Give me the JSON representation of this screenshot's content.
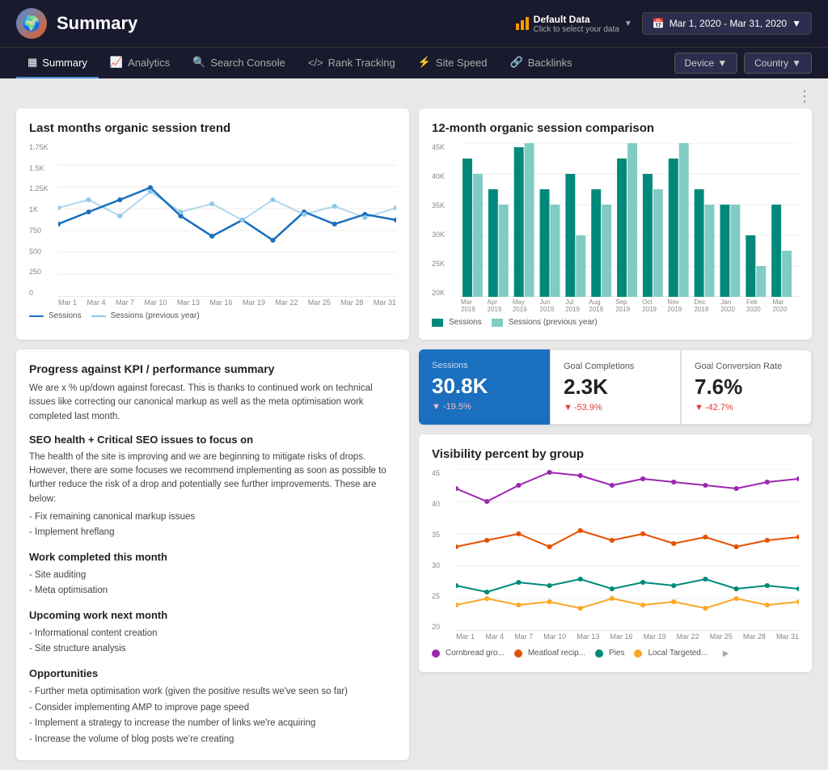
{
  "header": {
    "title": "Summary",
    "logo_emoji": "🌍",
    "data_label_line1": "Default Data",
    "data_label_line2": "Click to select your data",
    "date_range": "Mar 1, 2020 - Mar 31, 2020"
  },
  "nav": {
    "items": [
      {
        "label": "Summary",
        "icon": "▦",
        "active": true
      },
      {
        "label": "Analytics",
        "icon": "📈",
        "active": false
      },
      {
        "label": "Search Console",
        "icon": "🔍",
        "active": false
      },
      {
        "label": "Rank Tracking",
        "icon": "</>",
        "active": false
      },
      {
        "label": "Site Speed",
        "icon": "⚡",
        "active": false
      },
      {
        "label": "Backlinks",
        "icon": "🔗",
        "active": false
      }
    ],
    "device_label": "Device",
    "country_label": "Country"
  },
  "organic_trend": {
    "title": "Last months organic session trend",
    "y_labels": [
      "1.75K",
      "1.5K",
      "1.25K",
      "1K",
      "750",
      "500",
      "250",
      "0"
    ],
    "x_labels": [
      "Mar 1",
      "Mar 4",
      "Mar 7",
      "Mar 10",
      "Mar 13",
      "Mar 16",
      "Mar 19",
      "Mar 22",
      "Mar 25",
      "Mar 28",
      "Mar 31"
    ],
    "legend": [
      {
        "label": "Sessions",
        "color": "#1a6fbe"
      },
      {
        "label": "Sessions (previous year)",
        "color": "#90c8e8"
      }
    ]
  },
  "session_comparison": {
    "title": "12-month organic session comparison",
    "y_labels": [
      "45K",
      "40K",
      "35K",
      "30K",
      "25K",
      "20K"
    ],
    "x_labels": [
      "Mar 2019",
      "Apr 2019",
      "May 2019",
      "Jun 2019",
      "Jul 2019",
      "Aug 2019",
      "Sep 2019",
      "Oct 2019",
      "Nov 2019",
      "Dec 2019",
      "Jan 2020",
      "Feb 2020",
      "Mar 2020"
    ],
    "legend": [
      {
        "label": "Sessions",
        "color": "#00897b"
      },
      {
        "label": "Sessions (previous year)",
        "color": "#80cbc4"
      }
    ]
  },
  "performance_text": {
    "h2": "Progress against KPI / performance summary",
    "p1": "We are x % up/down against forecast. This is thanks to continued work on technical issues like correcting our canonical markup as well as the meta optimisation work completed last month.",
    "h3_1": "SEO health + Critical SEO issues to focus on",
    "p2": "The health of the site is improving and we are beginning to mitigate risks of drops. However, there are some focuses we recommend implementing as soon as possible to further reduce the risk of a drop and potentially see further improvements. These are below:",
    "bullets_1": [
      "- Fix remaining canonical markup issues",
      "- Implement hreflang"
    ],
    "h3_2": "Work completed this month",
    "bullets_2": [
      "- Site auditing",
      "- Meta optimisation"
    ],
    "h3_3": "Upcoming work next month",
    "bullets_3": [
      "- Informational content creation",
      "- Site structure analysis"
    ],
    "h3_4": "Opportunities",
    "bullets_4": [
      "- Further meta optimisation work (given the positive results we've seen so far)",
      "- Consider implementing AMP to improve page speed",
      "- Implement a strategy to increase the number of links we're acquiring",
      "- Increase the volume of blog posts we're creating"
    ]
  },
  "stats": [
    {
      "label": "Sessions",
      "value": "30.8K",
      "change": "▼ -19.5%",
      "down": true
    },
    {
      "label": "Goal Completions",
      "value": "2.3K",
      "change": "▼ -53.9%",
      "down": true
    },
    {
      "label": "Goal Conversion Rate",
      "value": "7.6%",
      "change": "▼ -42.7%",
      "down": true
    }
  ],
  "visibility": {
    "title": "Visibility percent by group",
    "y_labels": [
      "45",
      "40",
      "35",
      "30",
      "25",
      "20"
    ],
    "x_labels": [
      "Mar 1",
      "Mar 4",
      "Mar 7",
      "Mar 10",
      "Mar 13",
      "Mar 16",
      "Mar 19",
      "Mar 22",
      "Mar 25",
      "Mar 28",
      "Mar 31"
    ],
    "legend": [
      {
        "label": "Cornbread gro...",
        "color": "#9c27b0"
      },
      {
        "label": "Meatloaf recip...",
        "color": "#e65100"
      },
      {
        "label": "Pies",
        "color": "#00897b"
      },
      {
        "label": "Local Targeted...",
        "color": "#f9a825"
      }
    ]
  }
}
